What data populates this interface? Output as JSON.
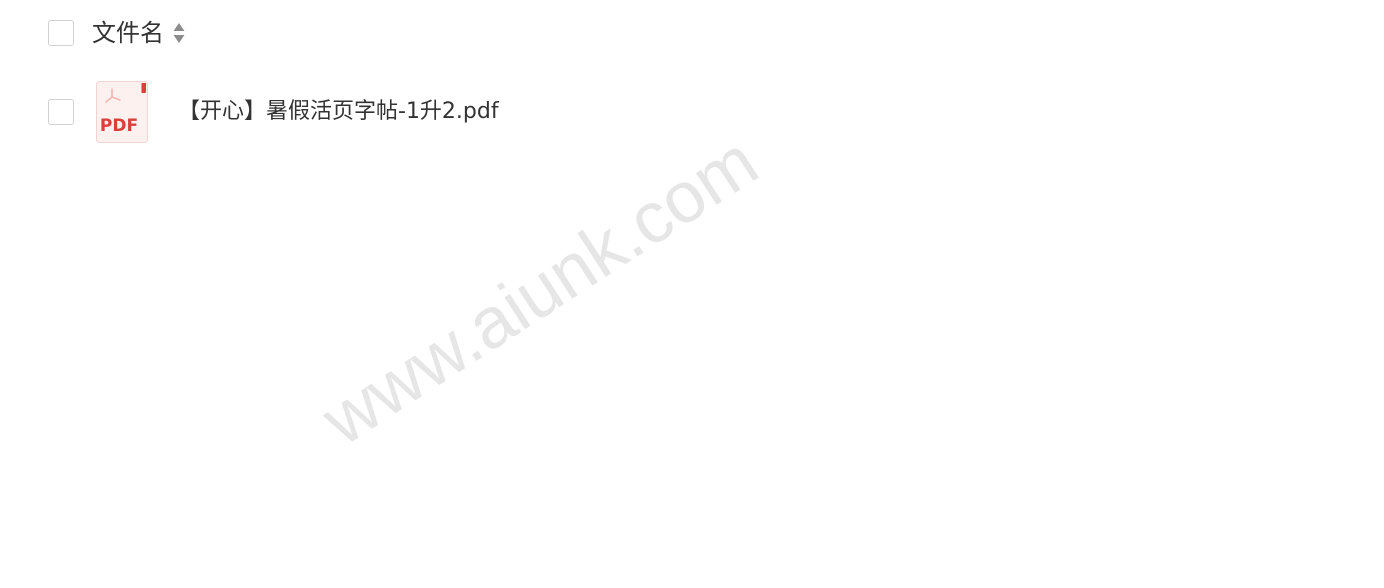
{
  "header": {
    "column_title": "文件名"
  },
  "files": [
    {
      "name": "【开心】暑假活页字帖-1升2.pdf",
      "type_icon": "pdf-file-icon",
      "icon_label": "PDF"
    }
  ],
  "watermark": {
    "text": "www.aiunk.com"
  },
  "colors": {
    "pdf_red": "#d9403a",
    "checkbox_border": "#d2d2d2",
    "text": "#333333",
    "sort_icon": "#8c8c8c",
    "watermark": "#e6e6e6"
  }
}
